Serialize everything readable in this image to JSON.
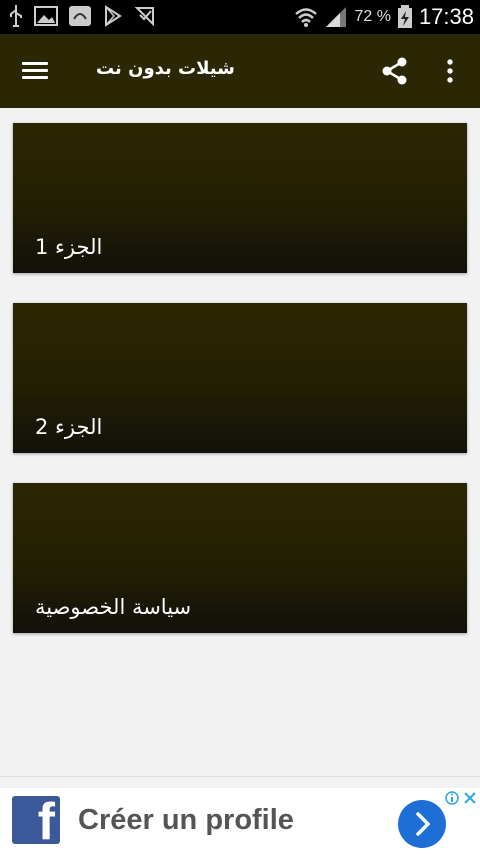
{
  "status_bar": {
    "battery_percent": "72 %",
    "time": "17:38"
  },
  "app_bar": {
    "title": "شيلات بدون نت",
    "icons": [
      "menu-icon",
      "share-icon",
      "more-vert-icon"
    ]
  },
  "cards": [
    {
      "label": "الجزء 1"
    },
    {
      "label": "الجزء 2"
    },
    {
      "label": "سياسة الخصوصية"
    }
  ],
  "ad": {
    "brand_icon": "facebook-logo",
    "text": "Créer un profile",
    "brand_color": "#3b5998",
    "button_icon": "chevron-right-icon"
  },
  "colors": {
    "app_bar": "#2b2603",
    "card_top": "#2b2603",
    "card_bottom": "#12110a",
    "background": "#f2f2f2"
  }
}
